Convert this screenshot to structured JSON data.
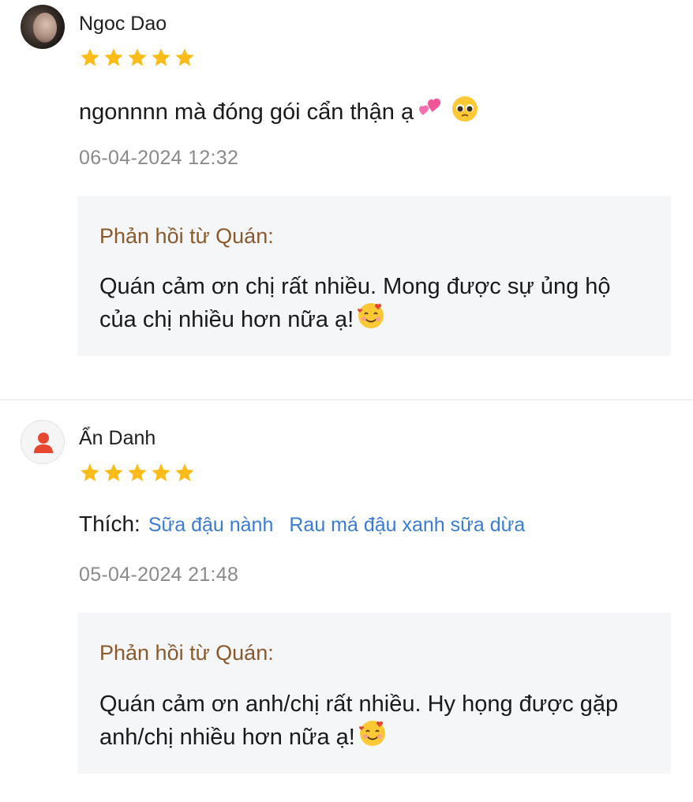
{
  "reviews": [
    {
      "name": "Ngoc Dao",
      "rating": 5,
      "comment": "ngonnnn mà đóng gói cẩn thận ạ",
      "date": "06-04-2024 12:32",
      "reply": {
        "title": "Phản hồi từ Quán:",
        "text": "Quán cảm ơn chị rất nhiều. Mong được sự ủng hộ của chị nhiều hơn nữa ạ!"
      }
    },
    {
      "name": "Ẩn Danh",
      "rating": 5,
      "likes_label": "Thích:",
      "likes": [
        "Sữa đậu nành",
        "Rau má đậu xanh sữa dừa"
      ],
      "date": "05-04-2024 21:48",
      "reply": {
        "title": "Phản hồi từ Quán:",
        "text": "Quán cảm ơn anh/chị rất nhiều. Hy họng được gặp anh/chị nhiều hơn nữa ạ!"
      }
    }
  ],
  "colors": {
    "star": "#fbbc1a",
    "like_link": "#3a7bd5",
    "reply_title": "#8a5a2c",
    "reply_bg": "#f4f6f8",
    "anon_icon": "#e8472f"
  },
  "icons": [
    "star-icon",
    "two-hearts-emoji",
    "pleading-face-emoji",
    "smiling-face-with-hearts-emoji",
    "anonymous-user-icon"
  ]
}
